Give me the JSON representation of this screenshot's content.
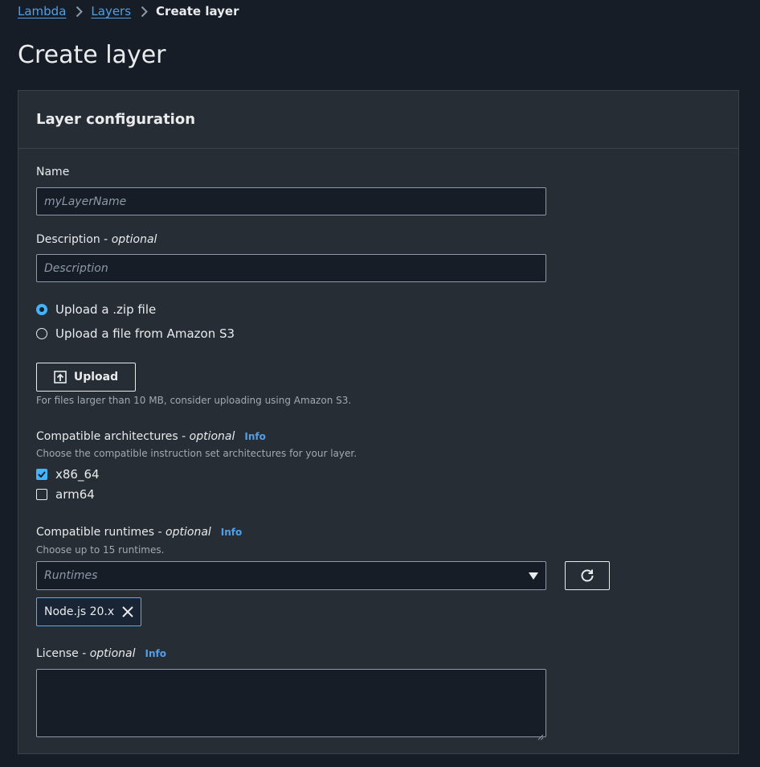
{
  "breadcrumb": {
    "items": [
      {
        "label": "Lambda"
      },
      {
        "label": "Layers"
      }
    ],
    "current": "Create layer"
  },
  "page": {
    "title": "Create layer"
  },
  "config": {
    "title": "Layer configuration",
    "name": {
      "label": "Name",
      "placeholder": "myLayerName",
      "value": ""
    },
    "description": {
      "label": "Description - ",
      "optional": "optional",
      "placeholder": "Description",
      "value": ""
    },
    "upload_options": [
      {
        "label": "Upload a .zip file",
        "selected": true
      },
      {
        "label": "Upload a file from Amazon S3",
        "selected": false
      }
    ],
    "upload": {
      "button_label": "Upload",
      "hint": "For files larger than 10 MB, consider uploading using Amazon S3.",
      "icon": "upload-icon"
    },
    "architectures": {
      "label": "Compatible architectures - ",
      "optional": "optional",
      "info": "Info",
      "hint": "Choose the compatible instruction set architectures for your layer.",
      "options": [
        {
          "label": "x86_64",
          "checked": true
        },
        {
          "label": "arm64",
          "checked": false
        }
      ]
    },
    "runtimes": {
      "label": "Compatible runtimes - ",
      "optional": "optional",
      "info": "Info",
      "hint": "Choose up to 15 runtimes.",
      "placeholder": "Runtimes",
      "selected_tokens": [
        {
          "label": "Node.js 20.x"
        }
      ]
    },
    "license": {
      "label": "License - ",
      "optional": "optional",
      "info": "Info",
      "value": ""
    }
  },
  "colors": {
    "background": "#161d26",
    "panel": "#272d35",
    "accent": "#42b4ff",
    "link": "#539fe5",
    "text": "#e9ebed"
  }
}
